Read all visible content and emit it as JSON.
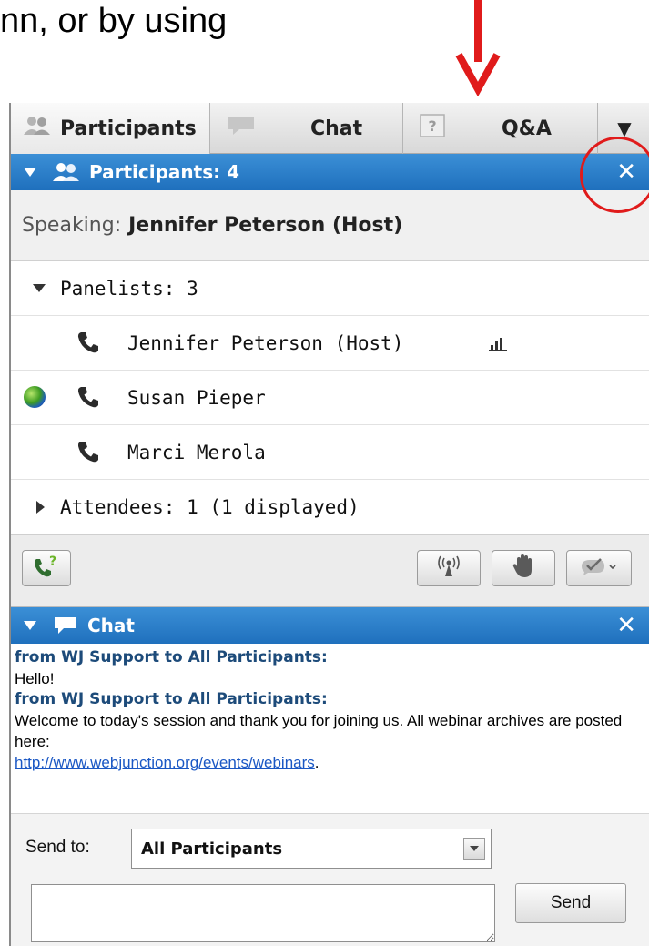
{
  "caption": {
    "text": "nn, or by using"
  },
  "tabs": [
    {
      "label": "Participants",
      "icon": "participants-icon"
    },
    {
      "label": "Chat",
      "icon": "chat-bubble-icon"
    },
    {
      "label": "Q&A",
      "icon": "question-icon"
    }
  ],
  "tab_more": {
    "icon": "chevron-down-icon",
    "glyph": "▼"
  },
  "participants_header": {
    "title": "Participants: 4",
    "close_glyph": "✕"
  },
  "speaking": {
    "label": "Speaking:",
    "name": "Jennifer Peterson (Host)"
  },
  "panelists": {
    "label": "Panelists: 3",
    "items": [
      {
        "name": "Jennifer Peterson (Host)"
      },
      {
        "name": "Susan Pieper"
      },
      {
        "name": "Marci Merola"
      }
    ]
  },
  "attendees": {
    "label": "Attendees: 1 (1 displayed)"
  },
  "toolbar": {
    "call_help_icon": "phone-question-icon",
    "broadcast_icon": "broadcast-icon",
    "raise_hand_icon": "raise-hand-icon",
    "feedback_icon": "checkmark-feedback-icon"
  },
  "chat_header": {
    "title": "Chat",
    "close_glyph": "✕"
  },
  "chat_messages": [
    {
      "from": "from WJ Support to All Participants:",
      "text": "Hello!"
    },
    {
      "from": "from WJ Support to All Participants:",
      "text": "Welcome to today's session and thank you for joining us. All webinar archives are posted here:",
      "link": "http://www.webjunction.org/events/webinars",
      "after_link": "."
    }
  ],
  "send": {
    "to_label": "Send to:",
    "to_value": "All Participants",
    "message_value": "",
    "button_label": "Send"
  },
  "colors": {
    "header_blue": "#1f70bd",
    "annotation_red": "#e01b1b",
    "chat_from": "#1d4b7a",
    "link": "#1a57c4"
  }
}
